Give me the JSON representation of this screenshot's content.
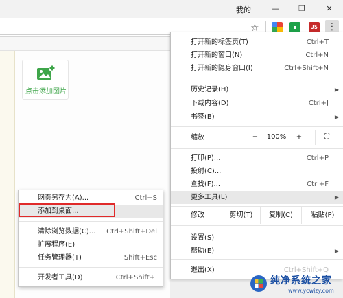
{
  "titlebar": {
    "user": "我的",
    "min_glyph": "—",
    "restore_glyph": "❐",
    "close_glyph": "✕"
  },
  "toolbar": {
    "star_glyph": "☆",
    "ext3_label": "JS",
    "menu_glyph": "⋮"
  },
  "page": {
    "add_image_label": "点击添加图片",
    "accent": "#3fa64a"
  },
  "menu": {
    "new_tab": {
      "label": "打开新的标签页(T)",
      "shortcut": "Ctrl+T"
    },
    "new_window": {
      "label": "打开新的窗口(N)",
      "shortcut": "Ctrl+N"
    },
    "incognito": {
      "label": "打开新的隐身窗口(I)",
      "shortcut": "Ctrl+Shift+N"
    },
    "history": {
      "label": "历史记录(H)"
    },
    "downloads": {
      "label": "下载内容(D)",
      "shortcut": "Ctrl+J"
    },
    "bookmarks": {
      "label": "书签(B)"
    },
    "zoom": {
      "label": "缩放",
      "minus": "−",
      "value": "100%",
      "plus": "+",
      "fullscreen": "⛶"
    },
    "print": {
      "label": "打印(P)...",
      "shortcut": "Ctrl+P"
    },
    "cast": {
      "label": "投射(C)..."
    },
    "find": {
      "label": "查找(F)...",
      "shortcut": "Ctrl+F"
    },
    "more_tools": {
      "label": "更多工具(L)"
    },
    "edit": {
      "label": "修改",
      "cut": "剪切(T)",
      "copy": "复制(C)",
      "paste": "粘贴(P)"
    },
    "settings": {
      "label": "设置(S)"
    },
    "help": {
      "label": "帮助(E)"
    },
    "exit": {
      "label": "退出(X)",
      "shortcut": "Ctrl+Shift+Q"
    },
    "arrow": "▶"
  },
  "submenu": {
    "save_as": {
      "label": "网页另存为(A)...",
      "shortcut": "Ctrl+S"
    },
    "add_desktop": {
      "label": "添加到桌面..."
    },
    "clear_data": {
      "label": "清除浏览数据(C)...",
      "shortcut": "Ctrl+Shift+Del"
    },
    "extensions": {
      "label": "扩展程序(E)"
    },
    "task_manager": {
      "label": "任务管理器(T)",
      "shortcut": "Shift+Esc"
    },
    "devtools": {
      "label": "开发者工具(D)",
      "shortcut": "Ctrl+Shift+I"
    }
  },
  "watermark": {
    "text": "纯净系统之家",
    "url": "www.ycwjzy.com"
  }
}
